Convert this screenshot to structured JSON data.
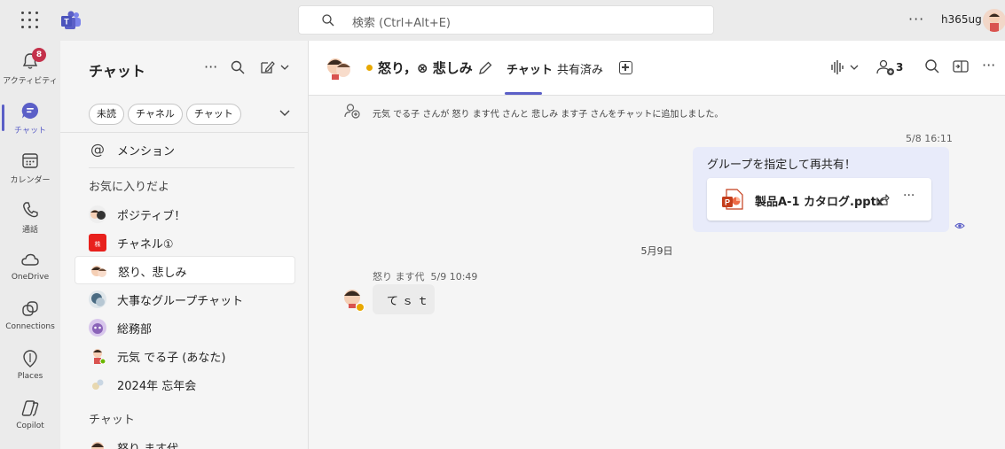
{
  "topbar": {
    "search_placeholder": "検索 (Ctrl+Alt+E)",
    "user_name": "h365ug"
  },
  "rail": {
    "items": [
      {
        "label": "アクティビティ",
        "badge": "8",
        "icon": "bell-icon"
      },
      {
        "label": "チャット",
        "icon": "chat-icon",
        "active": true
      },
      {
        "label": "カレンダー",
        "icon": "calendar-icon"
      },
      {
        "label": "通話",
        "icon": "phone-icon"
      },
      {
        "label": "OneDrive",
        "icon": "cloud-icon"
      },
      {
        "label": "Connections",
        "icon": "connections-icon"
      },
      {
        "label": "Places",
        "icon": "places-icon"
      },
      {
        "label": "Copilot",
        "icon": "copilot-icon"
      }
    ]
  },
  "chatlist": {
    "title": "チャット",
    "filters": [
      "未読",
      "チャネル",
      "チャット"
    ],
    "mentions": "メンション",
    "favorites_header": "お気に入りだよ",
    "favorites": [
      {
        "label": "ポジティブ！"
      },
      {
        "label": "チャネル①"
      },
      {
        "label": "怒り、悲しみ",
        "selected": true
      },
      {
        "label": "大事なグループチャット"
      },
      {
        "label": "総務部"
      },
      {
        "label": "元気 でる子 (あなた)"
      },
      {
        "label": "2024年 忘年会"
      }
    ],
    "chats_header": "チャット",
    "chats": [
      {
        "label": "怒り ます代"
      }
    ]
  },
  "header": {
    "title": "怒り，⊗ 悲しみ",
    "tabs": [
      "チャット",
      "共有済み"
    ],
    "participants_count": "3"
  },
  "messages": {
    "system": "元気 でる子 さんが 怒り ます代 さんと 悲しみ ます子 さんをチャットに追加しました。",
    "me_timestamp": "5/8 16:11",
    "me_text": "グループを指定して再共有！",
    "file_name": "製品A-1 カタログ.pptx",
    "date_separator": "5月9日",
    "other_sender": "怒り ます代",
    "other_timestamp": "5/9 10:49",
    "other_text": "てｓｔ"
  },
  "colors": {
    "brand": "#5b5fc7",
    "badge": "#c4314b",
    "away": "#e8a800",
    "my_bubble": "#e8ebfa"
  }
}
